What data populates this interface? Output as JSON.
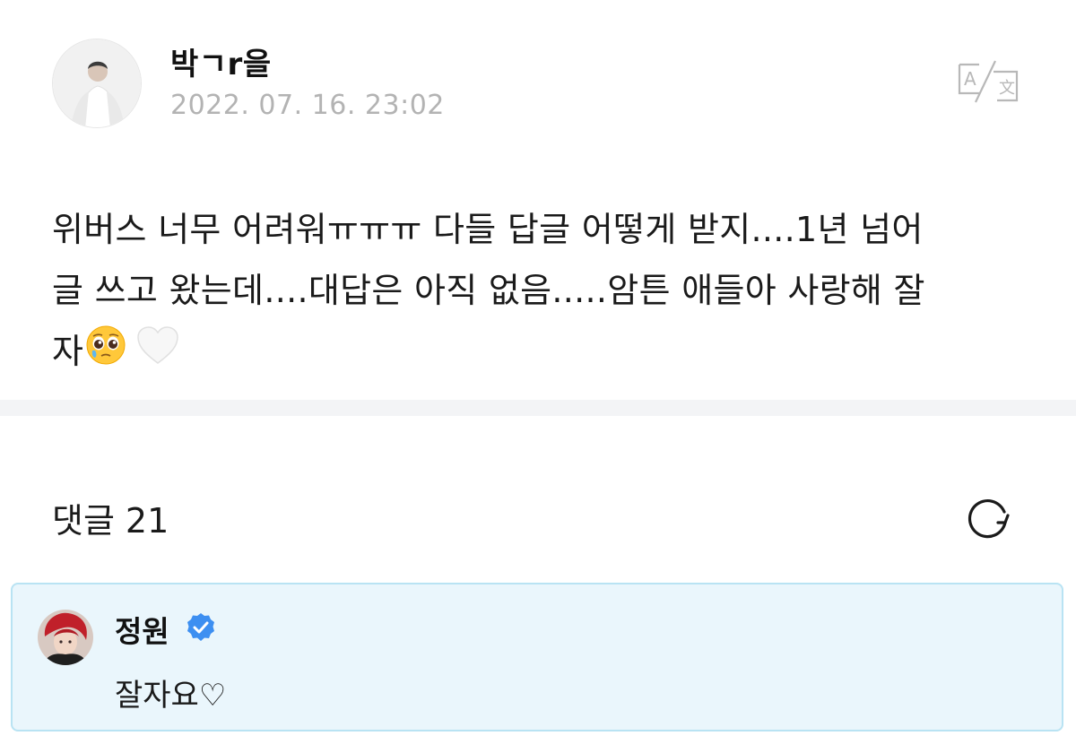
{
  "post": {
    "author": "박ㄱr을",
    "date": "2022. 07. 16. 23:02",
    "translate_icon": "translate-icon",
    "body_lines": [
      "위버스 너무 어려워ㅠㅠㅠ 다들 답글 어떻게 받지....1년 넘어",
      "글 쓰고 왔는데....대답은 아직 없음.....암튼 애들아 사랑해 잘",
      "자"
    ],
    "emojis": [
      "pleading-face",
      "white-heart"
    ]
  },
  "comments": {
    "label": "댓글",
    "count": "21",
    "refresh_icon": "refresh-icon",
    "items": [
      {
        "author": "정원",
        "verified": true,
        "text": "잘자요♡"
      }
    ]
  },
  "colors": {
    "date_gray": "#b3b3b3",
    "divider": "#f3f4f6",
    "comment_bg": "#eaf6fc",
    "comment_border": "#b9e3f3",
    "verified_blue": "#3d8ff1"
  }
}
